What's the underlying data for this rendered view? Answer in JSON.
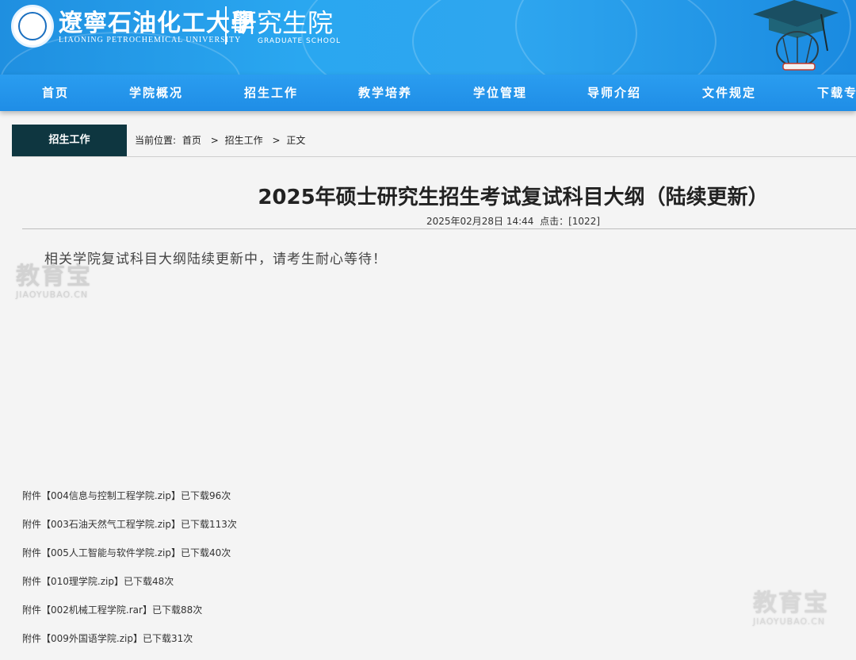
{
  "header": {
    "university_cn": "遼寧石油化工大學",
    "university_en": "LIAONING PETROCHEMICAL UNIVERSITY",
    "school_cn": "研究生院",
    "school_en": "GRADUATE SCHOOL"
  },
  "nav": {
    "items": [
      {
        "label": "首页"
      },
      {
        "label": "学院概况"
      },
      {
        "label": "招生工作"
      },
      {
        "label": "教学培养"
      },
      {
        "label": "学位管理"
      },
      {
        "label": "导师介绍"
      },
      {
        "label": "文件规定"
      },
      {
        "label": "下载专"
      }
    ]
  },
  "breadcrumb": {
    "section": "招生工作",
    "prefix": "当前位置:",
    "items": [
      "首页",
      "招生工作",
      "正文"
    ],
    "separator": ">"
  },
  "article": {
    "title": "2025年硕士研究生招生考试复试科目大纲（陆续更新）",
    "date": "2025年02月28日 14:44",
    "clicks_label": "点击：",
    "clicks": "[1022]",
    "body": "相关学院复试科目大纲陆续更新中，请考生耐心等待！"
  },
  "attachments": [
    {
      "text": "附件【004信息与控制工程学院.zip】已下载96次"
    },
    {
      "text": "附件【003石油天然气工程学院.zip】已下载113次"
    },
    {
      "text": "附件【005人工智能与软件学院.zip】已下载40次"
    },
    {
      "text": "附件【010理学院.zip】已下载48次"
    },
    {
      "text": "附件【002机械工程学院.rar】已下载88次"
    },
    {
      "text": "附件【009外国语学院.zip】已下载31次"
    }
  ],
  "watermark": {
    "cn": "教育宝",
    "en": "JIAOYUBAO.CN"
  },
  "colors": {
    "nav_blue": "#1f8de6",
    "section_tab": "#0e3640",
    "page_bg": "#f4f4f4"
  }
}
